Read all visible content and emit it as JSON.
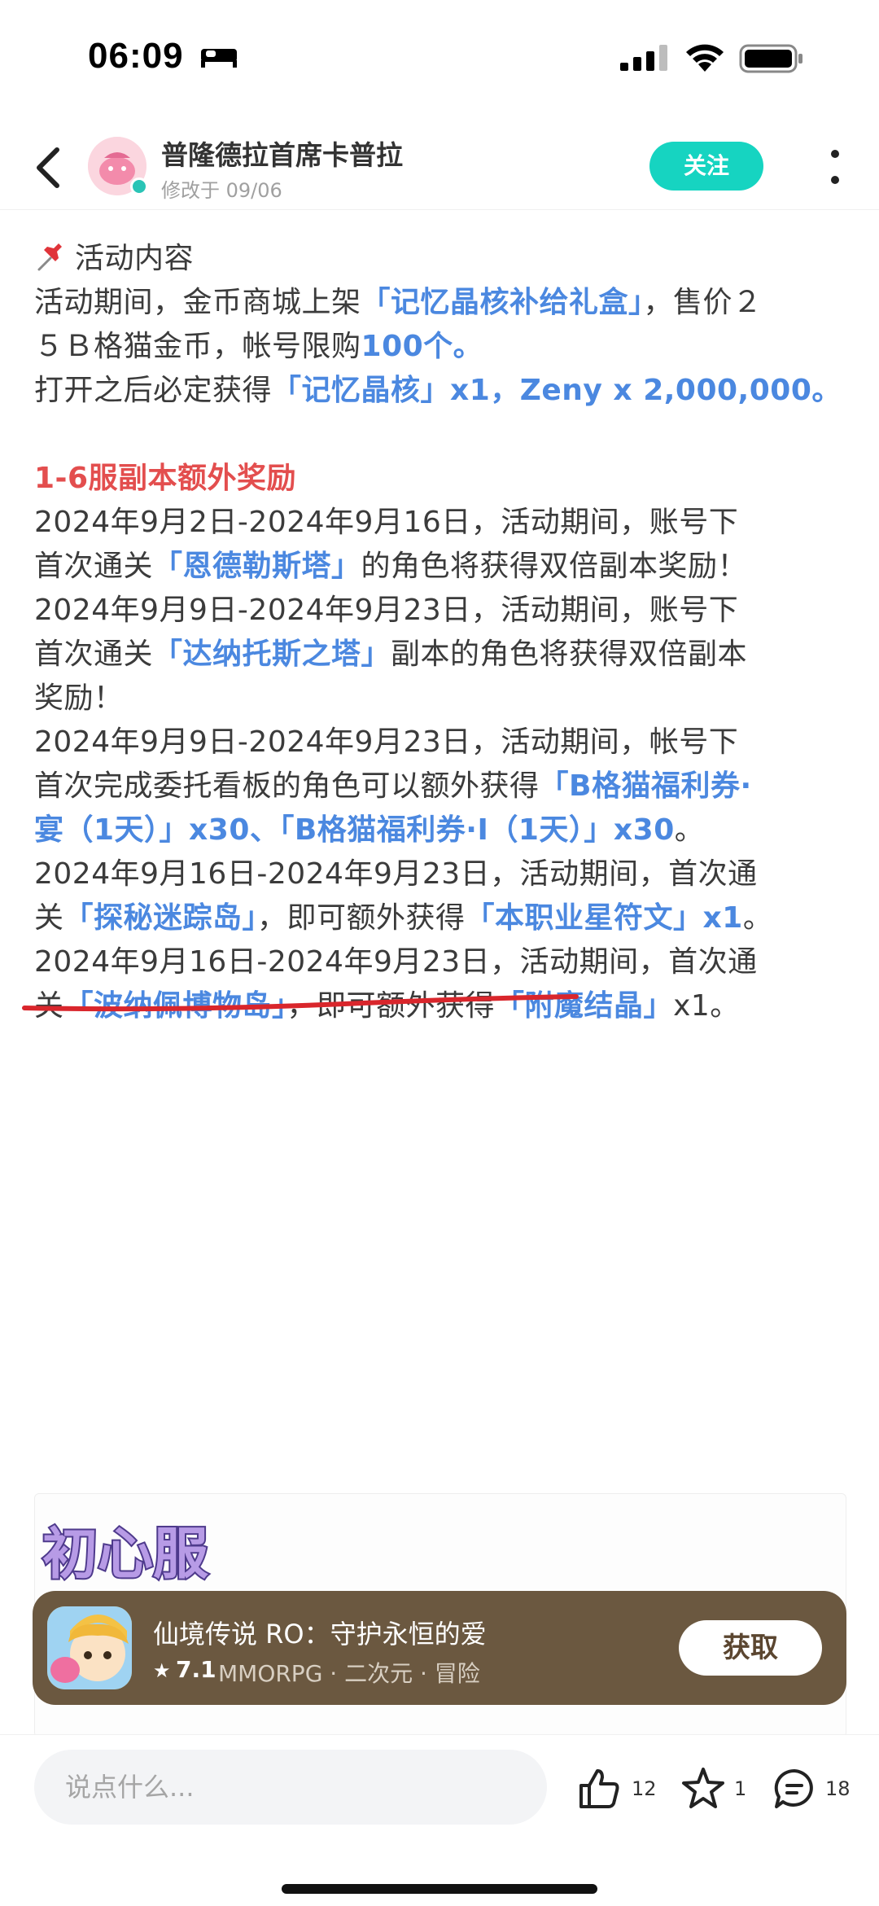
{
  "status_bar": {
    "time": "06:09"
  },
  "header": {
    "author_name": "普隆德拉首席卡普拉",
    "author_meta": "修改于 09/06",
    "follow_label": "关注"
  },
  "article": {
    "section_title": "活动内容",
    "p1_a": "活动期间，金币商城上架",
    "p1_b": "「记忆晶核补给礼盒」",
    "p1_c": "，售价２",
    "p2_a": "５Ｂ格猫金币，帐号限购",
    "p2_b": "100个。",
    "p3_a": "打开之后必定获得",
    "p3_b": "「记忆晶核」x1，Zeny x 2,000,000。",
    "bonus_title": "1-6服副本额外奖励",
    "r1_a": "2024年9月2日-2024年9月16日，活动期间，账号下",
    "r2_a": "首次通关",
    "r2_b": "「恩德勒斯塔」",
    "r2_c": "的角色将获得双倍副本奖励！",
    "r3_a": "2024年9月9日-2024年9月23日，活动期间，账号下",
    "r4_a": "首次通关",
    "r4_b": "「达纳托斯之塔」",
    "r4_c": "副本的角色将获得双倍副本",
    "r5_a": "奖励！",
    "r6_a": "2024年9月9日-2024年9月23日，活动期间，帐号下",
    "r7_a": "首次完成委托看板的角色可以额外获得",
    "r7_b": "「B格猫福利券·",
    "r8_a": "宴（1天）」x30、「B格猫福利券·I（1天）」x30",
    "r8_b": "。",
    "r9_a": "2024年9月16日-2024年9月23日，活动期间，首次通",
    "r10_a": "关",
    "r10_b": "「探秘迷踪岛」",
    "r10_c": "，即可额外获得",
    "r10_d": "「本职业星符文」x1",
    "r10_e": "。",
    "r11_a": "2024年9月16日-2024年9月23日，活动期间，首次通",
    "r12_a": "关",
    "r12_b": "「波纳佩博物岛」",
    "r12_c": "，即可额外获得",
    "r12_d": "「附魔结晶」",
    "r12_e": "x1。"
  },
  "banner": {
    "art_text": "初心服"
  },
  "app_card": {
    "name": "仙境传说 RO：守护永恒的爱",
    "rating": "7.1",
    "tags": "MMORPG · 二次元 · 冒险",
    "get_label": "获取"
  },
  "bottom_bar": {
    "comment_placeholder": "说点什么...",
    "like_count": "12",
    "favorite_count": "1",
    "comment_count": "18"
  },
  "colors": {
    "accent_teal": "#16d4c1",
    "link_blue": "#4b88e0",
    "section_red": "#e34e4e",
    "app_card_brown": "#6b5840"
  }
}
